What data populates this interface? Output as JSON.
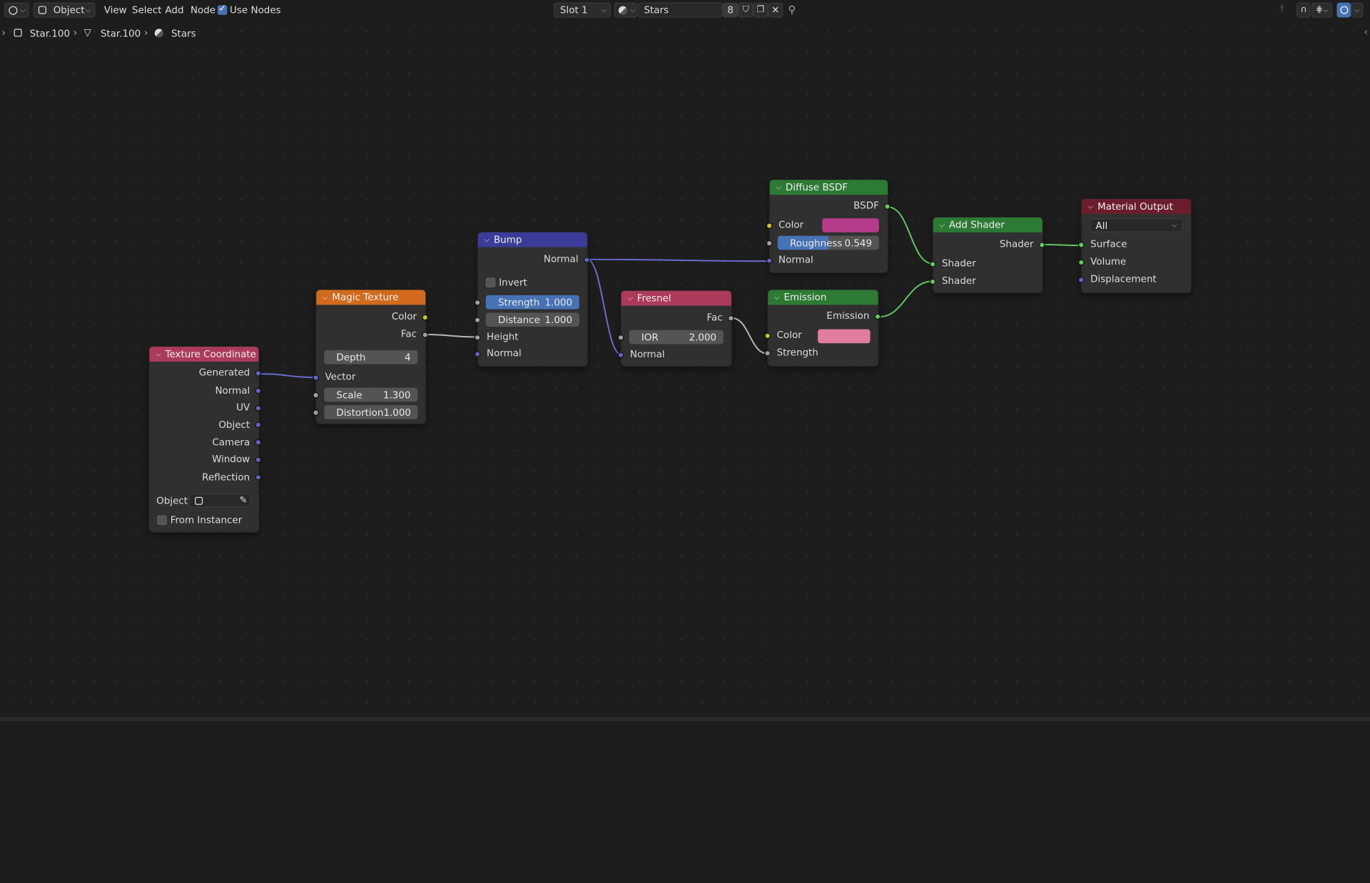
{
  "header": {
    "mode": "Object",
    "menus": [
      "View",
      "Select",
      "Add",
      "Node"
    ],
    "use_nodes_label": "Use Nodes",
    "use_nodes_checked": true,
    "slot": "Slot 1",
    "material_name": "Stars",
    "users_count": "8"
  },
  "breadcrumb": {
    "object": "Star.100",
    "mesh": "Star.100",
    "material": "Stars"
  },
  "nodes": {
    "texcoord": {
      "title": "Texture Coordinate",
      "outputs": [
        "Generated",
        "Normal",
        "UV",
        "Object",
        "Camera",
        "Window",
        "Reflection"
      ],
      "object_label": "Object:",
      "from_instancer": "From Instancer",
      "from_instancer_checked": false,
      "header_color": "#ab3a5b"
    },
    "magic": {
      "title": "Magic Texture",
      "outputs": [
        "Color",
        "Fac"
      ],
      "depth_label": "Depth",
      "depth_value": "4",
      "vector_label": "Vector",
      "scale_label": "Scale",
      "scale_value": "1.300",
      "distortion_label": "Distortion",
      "distortion_value": "1.000",
      "header_color": "#d16a1d"
    },
    "bump": {
      "title": "Bump",
      "normal_out": "Normal",
      "invert_label": "Invert",
      "invert_checked": false,
      "strength_label": "Strength",
      "strength_value": "1.000",
      "distance_label": "Distance",
      "distance_value": "1.000",
      "height_label": "Height",
      "normal_in": "Normal",
      "header_color": "#3b3b98"
    },
    "fresnel": {
      "title": "Fresnel",
      "fac_out": "Fac",
      "ior_label": "IOR",
      "ior_value": "2.000",
      "normal_in": "Normal",
      "header_color": "#ab3a5b"
    },
    "diffuse": {
      "title": "Diffuse BSDF",
      "bsdf_out": "BSDF",
      "color_label": "Color",
      "color_value": "#b43c8a",
      "roughness_label": "Roughness",
      "roughness_value": "0.549",
      "normal_in": "Normal",
      "header_color": "#2c7a34"
    },
    "emission": {
      "title": "Emission",
      "emission_out": "Emission",
      "color_label": "Color",
      "color_value": "#e27ca0",
      "strength_label": "Strength",
      "header_color": "#2c7a34"
    },
    "add_shader": {
      "title": "Add Shader",
      "shader_out": "Shader",
      "inputs": [
        "Shader",
        "Shader"
      ],
      "header_color": "#2c7a34"
    },
    "output": {
      "title": "Material Output",
      "target": "All",
      "inputs": [
        "Surface",
        "Volume",
        "Displacement"
      ],
      "header_color": "#6b1d2e"
    }
  }
}
